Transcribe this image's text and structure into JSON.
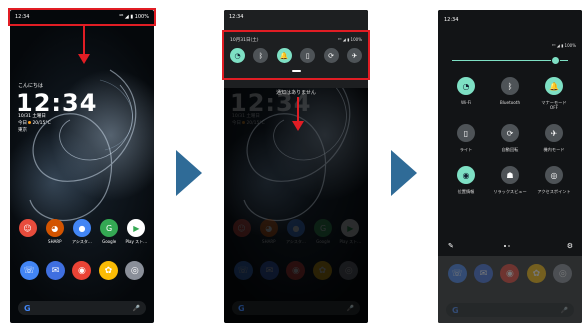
{
  "status": {
    "time": "12:34",
    "icons": "⁴ᴳ ◢ ▮ 100%"
  },
  "lock": {
    "greeting": "こんにちは",
    "clock": "12:34",
    "date": "10/31 土曜日",
    "weather_prefix": "今日",
    "weather": "20/15°C",
    "location": "東京"
  },
  "apps": [
    {
      "label": "",
      "icon": "☺",
      "color": "#e74c3c"
    },
    {
      "label": "SHARP",
      "icon": "◕",
      "color": "#d35400"
    },
    {
      "label": "アシスタ…",
      "icon": "●",
      "color": "#4285f4"
    },
    {
      "label": "Google",
      "icon": "G",
      "color": "#34a853"
    },
    {
      "label": "Play スト…",
      "icon": "▶",
      "color": "#ffffff"
    }
  ],
  "dock": [
    {
      "name": "phone-icon",
      "icon": "☏",
      "color": "#4285f4"
    },
    {
      "name": "messages-icon",
      "icon": "✉",
      "color": "#3f6fe0"
    },
    {
      "name": "chrome-icon",
      "icon": "◉",
      "color": "#ea4335"
    },
    {
      "name": "photos-icon",
      "icon": "✿",
      "color": "#fbbc05"
    },
    {
      "name": "camera-icon",
      "icon": "◎",
      "color": "#8a8f99"
    }
  ],
  "search": {
    "g": "G",
    "mic": "🎤"
  },
  "shade": {
    "date": "10月31日(土)",
    "status": "⁴ᴳ ◢ ▮ 100%",
    "no_notifications": "通知はありません"
  },
  "quick_tiles": [
    {
      "name": "wifi-tile",
      "icon": "◔",
      "on": true
    },
    {
      "name": "bluetooth-tile",
      "icon": "ᛒ",
      "on": false
    },
    {
      "name": "manner-mode-tile",
      "icon": "🔔",
      "on": true
    },
    {
      "name": "flashlight-tile",
      "icon": "▯",
      "on": false
    },
    {
      "name": "auto-rotate-tile",
      "icon": "⟳",
      "on": false
    },
    {
      "name": "airplane-mode-tile",
      "icon": "✈",
      "on": false
    }
  ],
  "full_tiles": [
    {
      "name": "wifi-tile",
      "icon": "◔",
      "label": "Wi-Fi",
      "on": true
    },
    {
      "name": "bluetooth-tile",
      "icon": "ᛒ",
      "label": "Bluetooth",
      "on": false
    },
    {
      "name": "manner-mode-tile",
      "icon": "🔔",
      "label": "マナーモード\nOFF",
      "on": true
    },
    {
      "name": "flashlight-tile",
      "icon": "▯",
      "label": "ライト",
      "on": false
    },
    {
      "name": "auto-rotate-tile",
      "icon": "⟳",
      "label": "自動回転",
      "on": false
    },
    {
      "name": "airplane-mode-tile",
      "icon": "✈",
      "label": "機内モード",
      "on": false
    },
    {
      "name": "location-tile",
      "icon": "◉",
      "label": "位置情報",
      "on": true
    },
    {
      "name": "reading-mode-tile",
      "icon": "☗",
      "label": "リラックスビュー",
      "on": false
    },
    {
      "name": "accessibility-tile",
      "icon": "◎",
      "label": "アクセスポイント",
      "on": false
    }
  ],
  "colors": {
    "highlight": "#e11d24",
    "accent": "#7ee0c4",
    "nav_arrow": "#2f6b97"
  }
}
